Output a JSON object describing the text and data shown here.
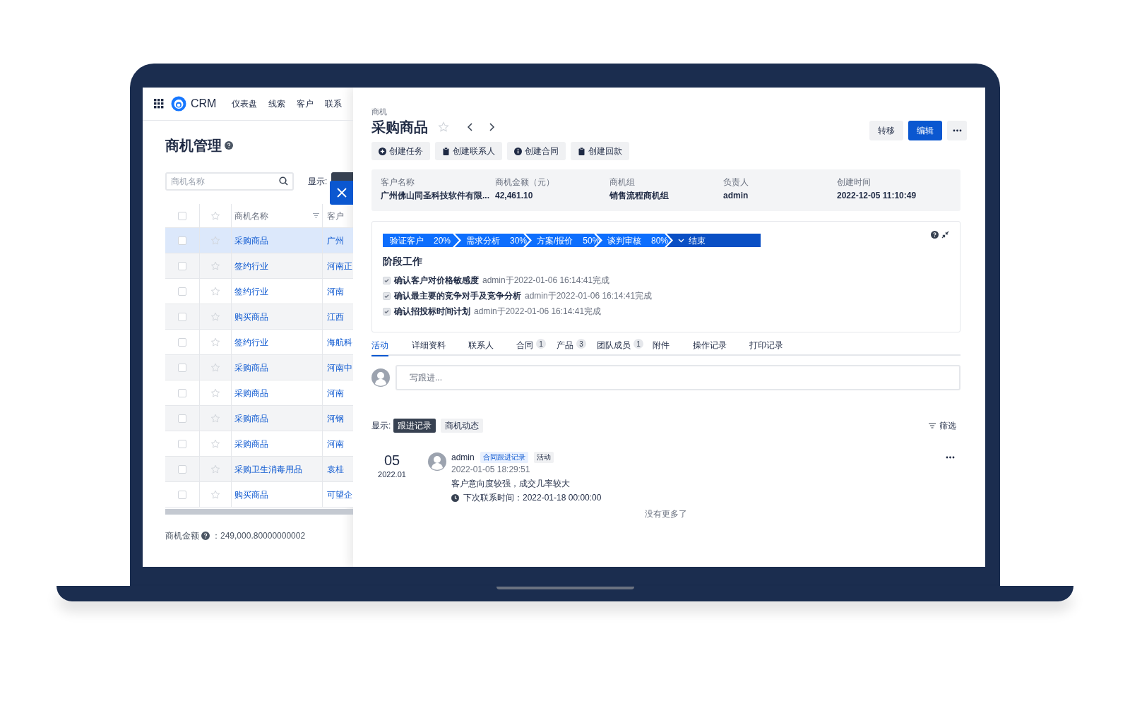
{
  "app": {
    "brand": "CRM",
    "nav": [
      "仪表盘",
      "线索",
      "客户",
      "联系"
    ]
  },
  "list_page": {
    "title": "商机管理",
    "search": {
      "placeholder": "商机名称"
    },
    "display_label": "显示:",
    "table": {
      "columns": [
        "商机名称",
        "客户"
      ],
      "select_all_checked": false,
      "rows": [
        {
          "name": "采购商品",
          "customer": "广州",
          "selected": true,
          "checked": false
        },
        {
          "name": "签约行业",
          "customer": "河南正",
          "selected": false,
          "checked": false
        },
        {
          "name": "签约行业",
          "customer": "河南",
          "selected": false,
          "checked": false
        },
        {
          "name": "购买商品",
          "customer": "江西",
          "selected": false,
          "checked": false
        },
        {
          "name": "签约行业",
          "customer": "海航科",
          "selected": false,
          "checked": false
        },
        {
          "name": "采购商品",
          "customer": "河南中",
          "selected": false,
          "checked": false
        },
        {
          "name": "采购商品",
          "customer": "河南",
          "selected": false,
          "checked": false
        },
        {
          "name": "采购商品",
          "customer": "河钢",
          "selected": false,
          "checked": false
        },
        {
          "name": "采购商品",
          "customer": "河南",
          "selected": false,
          "checked": false
        },
        {
          "name": "采购卫生消毒用品",
          "customer": "袁桂",
          "selected": false,
          "checked": false
        },
        {
          "name": "购买商品",
          "customer": "可望企",
          "selected": false,
          "checked": false
        }
      ]
    },
    "total": {
      "label": "商机金额",
      "value": "：249,000.80000000002"
    }
  },
  "detail": {
    "breadcrumb": "商机",
    "title": "采购商品",
    "header_buttons": [
      {
        "kind": "default",
        "label": "转移"
      },
      {
        "kind": "primary",
        "label": "编辑"
      },
      {
        "kind": "more"
      }
    ],
    "actions": [
      {
        "kind": "plus",
        "label": "创建任务"
      },
      {
        "kind": "clipboard",
        "label": "创建联系人"
      },
      {
        "kind": "info",
        "label": "创建合同"
      },
      {
        "kind": "clipboard",
        "label": "创建回款"
      }
    ],
    "summary": [
      {
        "label": "客户名称",
        "value": "广州佛山同圣科技软件有限..."
      },
      {
        "label": "商机金额（元）",
        "value": "42,461.10"
      },
      {
        "label": "商机组",
        "value": "销售流程商机组"
      },
      {
        "label": "负责人",
        "value": "admin"
      },
      {
        "label": "创建时间",
        "value": "2022-12-05 11:10:49"
      }
    ],
    "stages": [
      {
        "name": "验证客户",
        "percent": "20%",
        "selected": false
      },
      {
        "name": "需求分析",
        "percent": "30%",
        "selected": false
      },
      {
        "name": "方案/报价",
        "percent": "50%",
        "selected": false
      },
      {
        "name": "谈判审核",
        "percent": "80%",
        "selected": false
      },
      {
        "name": "结束",
        "selected": true
      }
    ],
    "stage_work": {
      "title": "阶段工作",
      "items": [
        {
          "task": "确认客户对价格敏感度",
          "meta": "admin于2022-01-06 16:14:41完成",
          "checked": true
        },
        {
          "task": "确认最主要的竞争对手及竞争分析",
          "meta": "admin于2022-01-06 16:14:41完成",
          "checked": true
        },
        {
          "task": "确认招投标时间计划",
          "meta": "admin于2022-01-06 16:14:41完成",
          "checked": true
        }
      ]
    },
    "tabs": [
      {
        "label": "活动",
        "selected": true
      },
      {
        "label": "详细资料",
        "selected": false
      },
      {
        "label": "联系人",
        "selected": false
      },
      {
        "label": "合同",
        "count": "1",
        "selected": false
      },
      {
        "label": "产品",
        "count": "3",
        "selected": false
      },
      {
        "label": "团队成员",
        "count": "1",
        "selected": false
      },
      {
        "label": "附件",
        "selected": false
      },
      {
        "label": "操作记录",
        "selected": false
      },
      {
        "label": "打印记录",
        "selected": false
      }
    ],
    "composer": {
      "placeholder": "写跟进..."
    },
    "feed_filter": {
      "label": "显示:",
      "options": [
        {
          "label": "跟进记录",
          "selected": true
        },
        {
          "label": "商机动态",
          "selected": false
        }
      ],
      "filter": "筛选"
    },
    "entries": [
      {
        "day": "05",
        "month": "2022.01",
        "author": "admin",
        "tags": [
          {
            "kind": "link",
            "label": "合同跟进记录"
          },
          {
            "kind": "plain",
            "label": "活动"
          }
        ],
        "time": "2022-01-05 18:29:51",
        "text": "客户意向度较强，成交几率较大",
        "next_contact": "下次联系时间：2022-01-18 00:00:00"
      }
    ],
    "end_note": "没有更多了"
  }
}
